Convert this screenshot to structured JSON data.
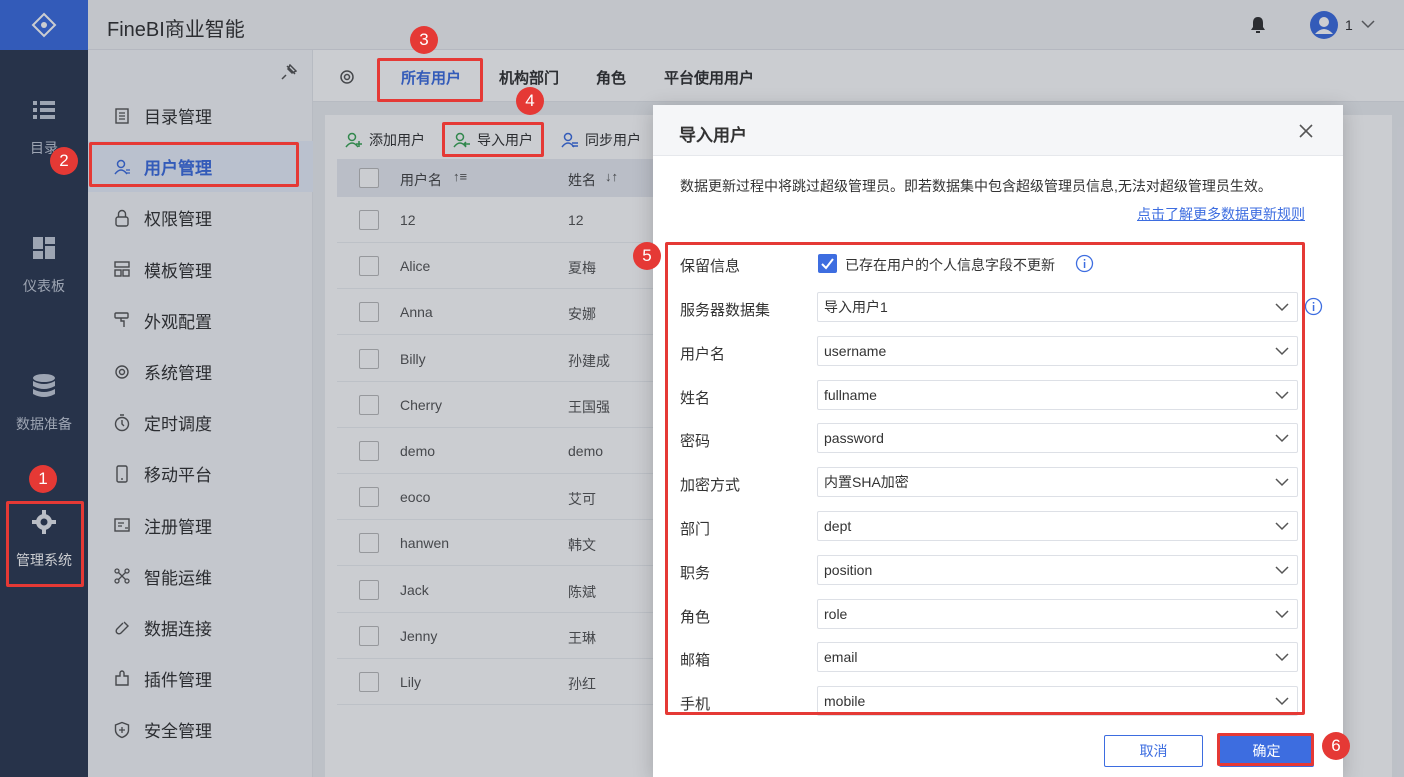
{
  "app": {
    "title": "FineBI商业智能",
    "user_count": "1"
  },
  "rail": {
    "items": [
      {
        "label": "目录",
        "icon": "list-icon"
      },
      {
        "label": "仪表板",
        "icon": "dashboard-icon"
      },
      {
        "label": "数据准备",
        "icon": "database-icon"
      },
      {
        "label": "管理系统",
        "icon": "gear-icon"
      }
    ]
  },
  "nav": {
    "items": [
      {
        "label": "目录管理",
        "icon": "catalog-icon"
      },
      {
        "label": "用户管理",
        "icon": "user-icon"
      },
      {
        "label": "权限管理",
        "icon": "lock-icon"
      },
      {
        "label": "模板管理",
        "icon": "template-icon"
      },
      {
        "label": "外观配置",
        "icon": "paint-icon"
      },
      {
        "label": "系统管理",
        "icon": "settings-icon"
      },
      {
        "label": "定时调度",
        "icon": "timer-icon"
      },
      {
        "label": "移动平台",
        "icon": "mobile-icon"
      },
      {
        "label": "注册管理",
        "icon": "register-icon"
      },
      {
        "label": "智能运维",
        "icon": "ops-icon"
      },
      {
        "label": "数据连接",
        "icon": "link-icon"
      },
      {
        "label": "插件管理",
        "icon": "plugin-icon"
      },
      {
        "label": "安全管理",
        "icon": "shield-icon"
      }
    ]
  },
  "tabs": [
    "所有用户",
    "机构部门",
    "角色",
    "平台使用用户"
  ],
  "toolbar": {
    "add": "添加用户",
    "import": "导入用户",
    "sync": "同步用户"
  },
  "table": {
    "headers": [
      "用户名",
      "姓名"
    ],
    "rows": [
      [
        "12",
        "12"
      ],
      [
        "Alice",
        "夏梅"
      ],
      [
        "Anna",
        "安娜"
      ],
      [
        "Billy",
        "孙建成"
      ],
      [
        "Cherry",
        "王国强"
      ],
      [
        "demo",
        "demo"
      ],
      [
        "eoco",
        "艾可"
      ],
      [
        "hanwen",
        "韩文"
      ],
      [
        "Jack",
        "陈斌"
      ],
      [
        "Jenny",
        "王琳"
      ],
      [
        "Lily",
        "孙红"
      ]
    ]
  },
  "dialog": {
    "title": "导入用户",
    "note": "数据更新过程中将跳过超级管理员。即若数据集中包含超级管理员信息,无法对超级管理员生效。",
    "link": "点击了解更多数据更新规则",
    "keep_label": "保留信息",
    "keep_text": "已存在用户的个人信息字段不更新",
    "fields": [
      {
        "label": "服务器数据集",
        "value": "导入用户1"
      },
      {
        "label": "用户名",
        "value": "username"
      },
      {
        "label": "姓名",
        "value": "fullname"
      },
      {
        "label": "密码",
        "value": "password"
      },
      {
        "label": "加密方式",
        "value": "内置SHA加密"
      },
      {
        "label": "部门",
        "value": "dept"
      },
      {
        "label": "职务",
        "value": "position"
      },
      {
        "label": "角色",
        "value": "role"
      },
      {
        "label": "邮箱",
        "value": "email"
      },
      {
        "label": "手机",
        "value": "mobile"
      }
    ],
    "cancel": "取消",
    "ok": "确定"
  },
  "annotations": [
    "1",
    "2",
    "3",
    "4",
    "5",
    "6"
  ],
  "colors": {
    "accent": "#3d6de0",
    "annotation": "#e53935",
    "rail": "#2e3a52"
  }
}
